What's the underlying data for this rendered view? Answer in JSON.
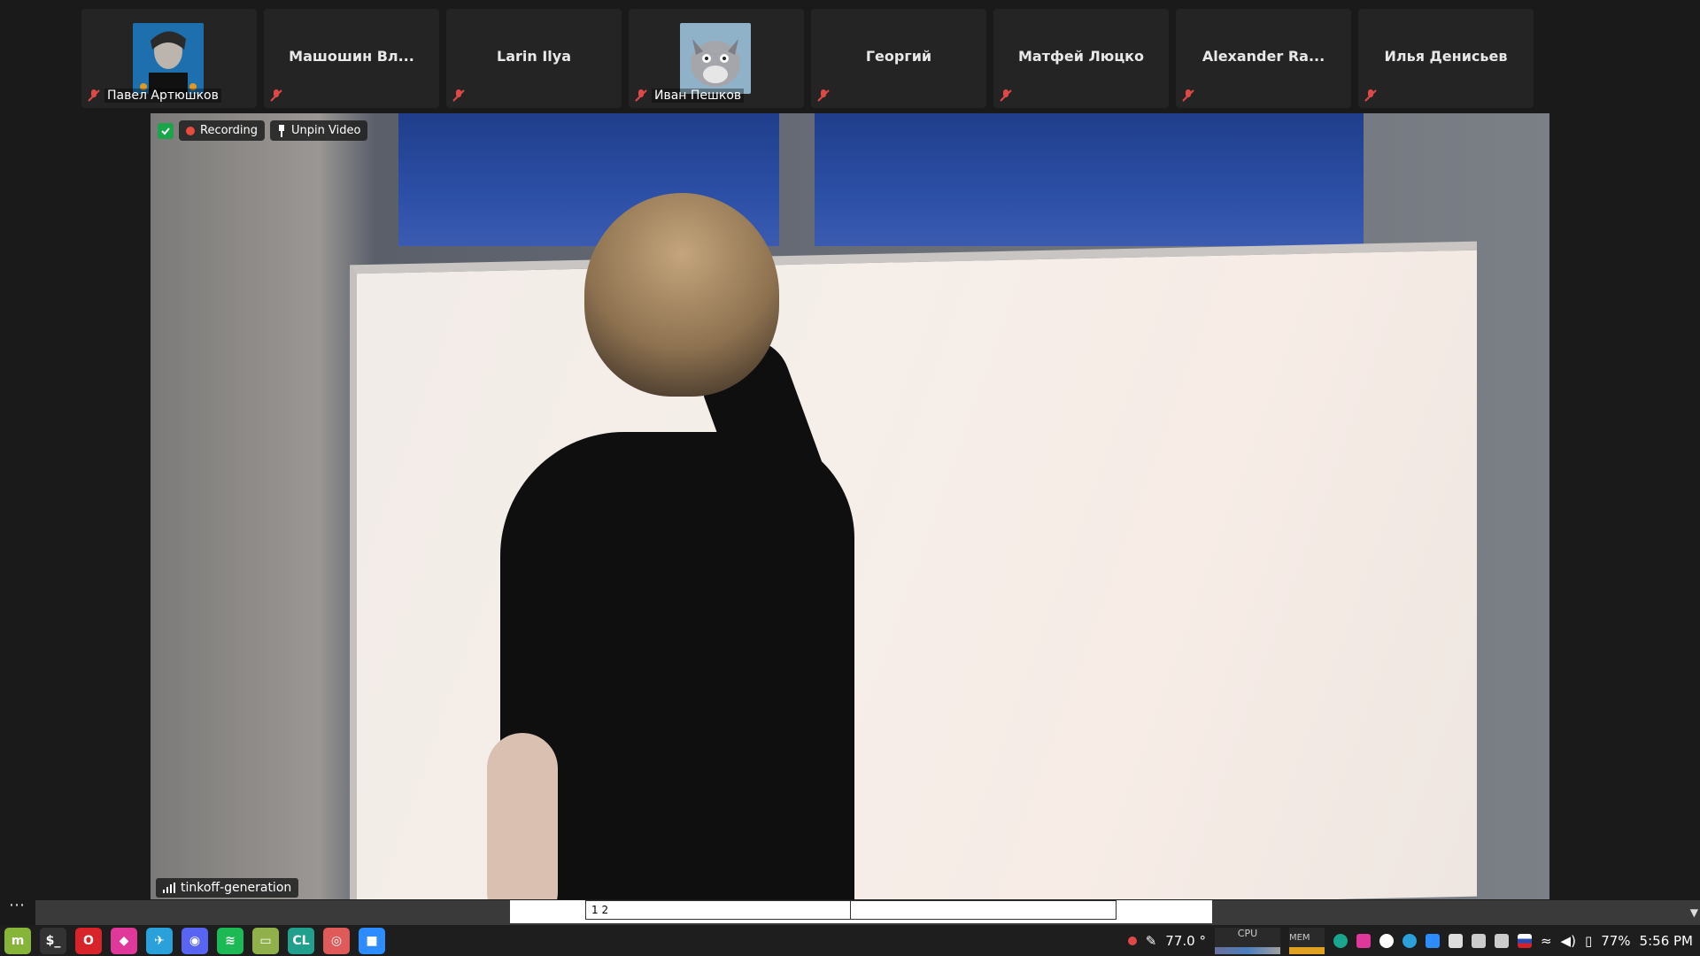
{
  "participants": [
    {
      "name": "Павел Артюшков",
      "has_avatar": true,
      "muted": true
    },
    {
      "name": "Машошин Вл...",
      "has_avatar": false,
      "muted": true
    },
    {
      "name": "Larin Ilya",
      "has_avatar": false,
      "muted": true
    },
    {
      "name": "Иван Пешков",
      "has_avatar": true,
      "muted": true
    },
    {
      "name": "Георгий",
      "has_avatar": false,
      "muted": true
    },
    {
      "name": "Матфей Люцко",
      "has_avatar": false,
      "muted": true
    },
    {
      "name": "Alexander Ra...",
      "has_avatar": false,
      "muted": true
    },
    {
      "name": "Илья Денисьев",
      "has_avatar": false,
      "muted": true
    }
  ],
  "main_video": {
    "recording_label": "Recording",
    "unpin_label": "Unpin Video",
    "speaker_name": "tinkoff-generation"
  },
  "workspace_switcher": {
    "label": "1 2"
  },
  "taskbar": {
    "apps": [
      {
        "name": "mint-menu-icon",
        "glyph": "m",
        "color": "#87b53a"
      },
      {
        "name": "terminal-icon",
        "glyph": "$_",
        "color": "#333333"
      },
      {
        "name": "opera-icon",
        "glyph": "O",
        "color": "#d8232a"
      },
      {
        "name": "jetbrains-toolbox-icon",
        "glyph": "◆",
        "color": "#e0389a"
      },
      {
        "name": "telegram-icon",
        "glyph": "✈",
        "color": "#2aa1da"
      },
      {
        "name": "discord-icon",
        "glyph": "◉",
        "color": "#5865f2"
      },
      {
        "name": "spotify-icon",
        "glyph": "≋",
        "color": "#1db954"
      },
      {
        "name": "files-icon",
        "glyph": "▭",
        "color": "#8fb04a"
      },
      {
        "name": "clion-icon",
        "glyph": "CL",
        "color": "#21a08e"
      },
      {
        "name": "game-icon",
        "glyph": "◎",
        "color": "#e05a5a"
      },
      {
        "name": "zoom-icon",
        "glyph": "■",
        "color": "#2d8cff"
      }
    ],
    "temperature": "77.0 °",
    "cpu_label": "CPU",
    "mem_label": "MEM",
    "battery": "77%",
    "time": "5:56 PM"
  }
}
